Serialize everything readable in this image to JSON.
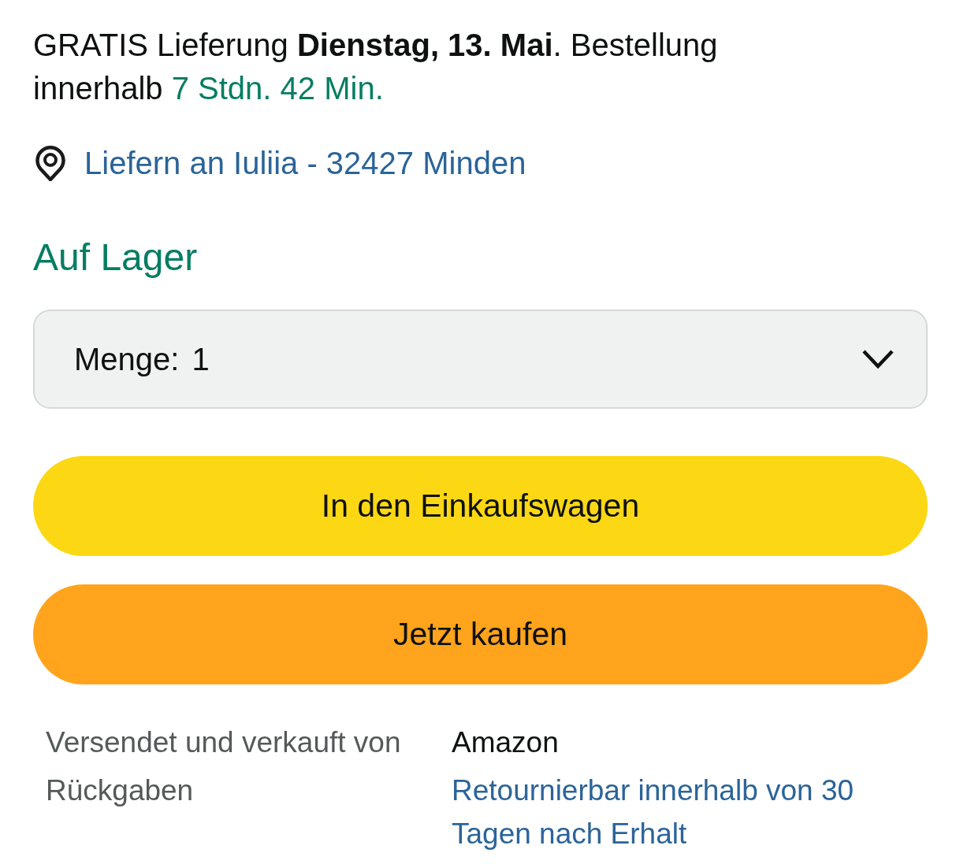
{
  "delivery": {
    "text": "GRATIS Lieferung **Dienstag, 13. Mai**. Bestellung innerhalb",
    "countdown": "7 Stdn. 42 Min."
  },
  "location": {
    "text": "Liefern an Iuliia - 32427 Minden"
  },
  "availability": "Auf Lager",
  "quantity": {
    "label": "Menge:",
    "value": "1"
  },
  "buttons": [
    {
      "label": "In den Einkaufswagen",
      "kind": "cart"
    },
    {
      "label": "Jetzt kaufen",
      "kind": "buy"
    }
  ],
  "details": [
    {
      "label": "Versendet und verkauft von",
      "value": "Amazon",
      "kind": "text"
    },
    {
      "label": "Rückgaben",
      "value": "Retournierbar innerhalb von 30 Tagen nach Erhalt",
      "kind": "link"
    }
  ]
}
